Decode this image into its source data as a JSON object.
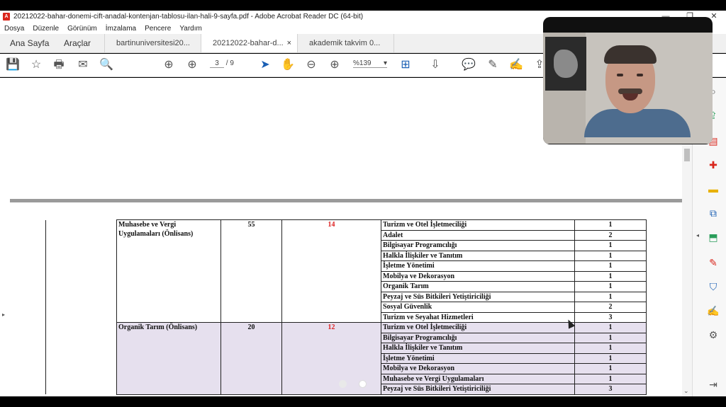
{
  "window": {
    "title": "20212022-bahar-donemi-cift-anadal-kontenjan-tablosu-ilan-hali-9-sayfa.pdf - Adobe Acrobat Reader DC (64-bit)",
    "pdf_logo": "A",
    "minimize": "—",
    "maximize": "❐",
    "close": "✕"
  },
  "menu": [
    "Dosya",
    "Düzenle",
    "Görünüm",
    "İmzalama",
    "Pencere",
    "Yardım"
  ],
  "tabs": {
    "home": "Ana Sayfa",
    "tools": "Araçlar",
    "docs": [
      {
        "label": "bartinuniversitesi20...",
        "active": false,
        "close": ""
      },
      {
        "label": "20212022-bahar-d...",
        "active": true,
        "close": "×"
      },
      {
        "label": "akademik takvim 0...",
        "active": false,
        "close": ""
      }
    ]
  },
  "toolbar": {
    "page_current": "3",
    "page_total": "/ 9",
    "zoom": "%139",
    "zoom_caret": "▾"
  },
  "table": {
    "rows": [
      {
        "program": "Muhasebe ve Vergi Uygulamaları (Önlisans)",
        "quota": "55",
        "count": "14",
        "dept": "Turizm ve Otel İşletmeciliği",
        "n": "1",
        "shade": false,
        "first": true,
        "span": 10
      },
      {
        "dept": "Adalet",
        "n": "2",
        "shade": false
      },
      {
        "dept": "Bilgisayar Programcılığı",
        "n": "1",
        "shade": false
      },
      {
        "dept": "Halkla İlişkiler ve Tanıtım",
        "n": "1",
        "shade": false
      },
      {
        "dept": "İşletme Yönetimi",
        "n": "1",
        "shade": false
      },
      {
        "dept": "Mobilya ve Dekorasyon",
        "n": "1",
        "shade": false
      },
      {
        "dept": "Organik Tarım",
        "n": "1",
        "shade": false
      },
      {
        "dept": "Peyzaj ve Süs Bitkileri Yetiştiriciliği",
        "n": "1",
        "shade": false
      },
      {
        "dept": "Sosyal Güvenlik",
        "n": "2",
        "shade": false
      },
      {
        "dept": "Turizm ve Seyahat Hizmetleri",
        "n": "3",
        "shade": false
      },
      {
        "program": "Organik Tarım (Önlisans)",
        "quota": "20",
        "count": "12",
        "dept": "Turizm ve Otel İşletmeciliği",
        "n": "1",
        "shade": true,
        "first": true,
        "span": 7
      },
      {
        "dept": "Bilgisayar Programcılığı",
        "n": "1",
        "shade": true
      },
      {
        "dept": "Halkla İlişkiler ve Tanıtım",
        "n": "1",
        "shade": true
      },
      {
        "dept": "İşletme Yönetimi",
        "n": "1",
        "shade": true
      },
      {
        "dept": "Mobilya ve Dekorasyon",
        "n": "1",
        "shade": true
      },
      {
        "dept": "Muhasebe ve Vergi Uygulamaları",
        "n": "1",
        "shade": true
      },
      {
        "dept": "Peyzaj ve Süs Bitkileri Yetiştiriciliği",
        "n": "3",
        "shade": true
      }
    ]
  },
  "icons": {
    "save": "💾",
    "bookmark": "☆",
    "print": "🖶",
    "mail": "✉",
    "search": "🔍",
    "prev_page": "⊕",
    "next_page": "⊕",
    "select": "➤",
    "hand": "✋",
    "zoom_out": "⊖",
    "zoom_in": "⊕",
    "fit": "⊞",
    "scroll": "⇩",
    "comment": "💬",
    "highlight": "✎",
    "sign": "✍",
    "share": "⇪",
    "left_arrow": "▸",
    "right_arrow": "◂",
    "scroll_down": "⌄"
  },
  "colors": {
    "accent": "#d9261c",
    "shade": "#e6e0ee",
    "red_number": "#d22222"
  }
}
